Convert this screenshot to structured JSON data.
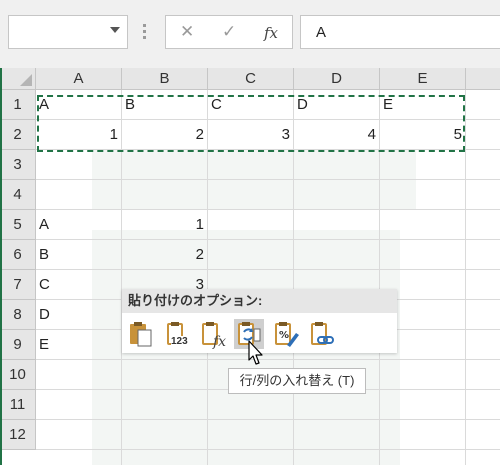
{
  "formula_bar": {
    "name_box_value": "",
    "cancel_icon": "✕",
    "enter_icon": "✓",
    "fx_label": "fx",
    "formula_value": "A"
  },
  "columns": [
    "A",
    "B",
    "C",
    "D",
    "E"
  ],
  "rows": [
    "1",
    "2",
    "3",
    "4",
    "5",
    "6",
    "7",
    "8",
    "9",
    "10",
    "11",
    "12"
  ],
  "cells": {
    "r1": [
      "A",
      "B",
      "C",
      "D",
      "E"
    ],
    "r2": [
      "1",
      "2",
      "3",
      "4",
      "5"
    ],
    "r5": [
      "A",
      "1"
    ],
    "r6": [
      "B",
      "2"
    ],
    "r7": [
      "C",
      "3"
    ],
    "r8": [
      "D",
      ""
    ],
    "r9": [
      "E",
      ""
    ]
  },
  "paste_options": {
    "title": "貼り付けのオプション:",
    "icons": [
      "paste-icon",
      "paste-values-icon",
      "paste-formulas-icon",
      "transpose-icon",
      "paste-formatting-icon",
      "paste-link-icon"
    ],
    "values_label": "123",
    "tooltip": "行/列の入れ替え (T)"
  },
  "colors": {
    "accent": "#217346",
    "icon_gold": "#c8923a",
    "icon_blue": "#2e6fb7"
  }
}
